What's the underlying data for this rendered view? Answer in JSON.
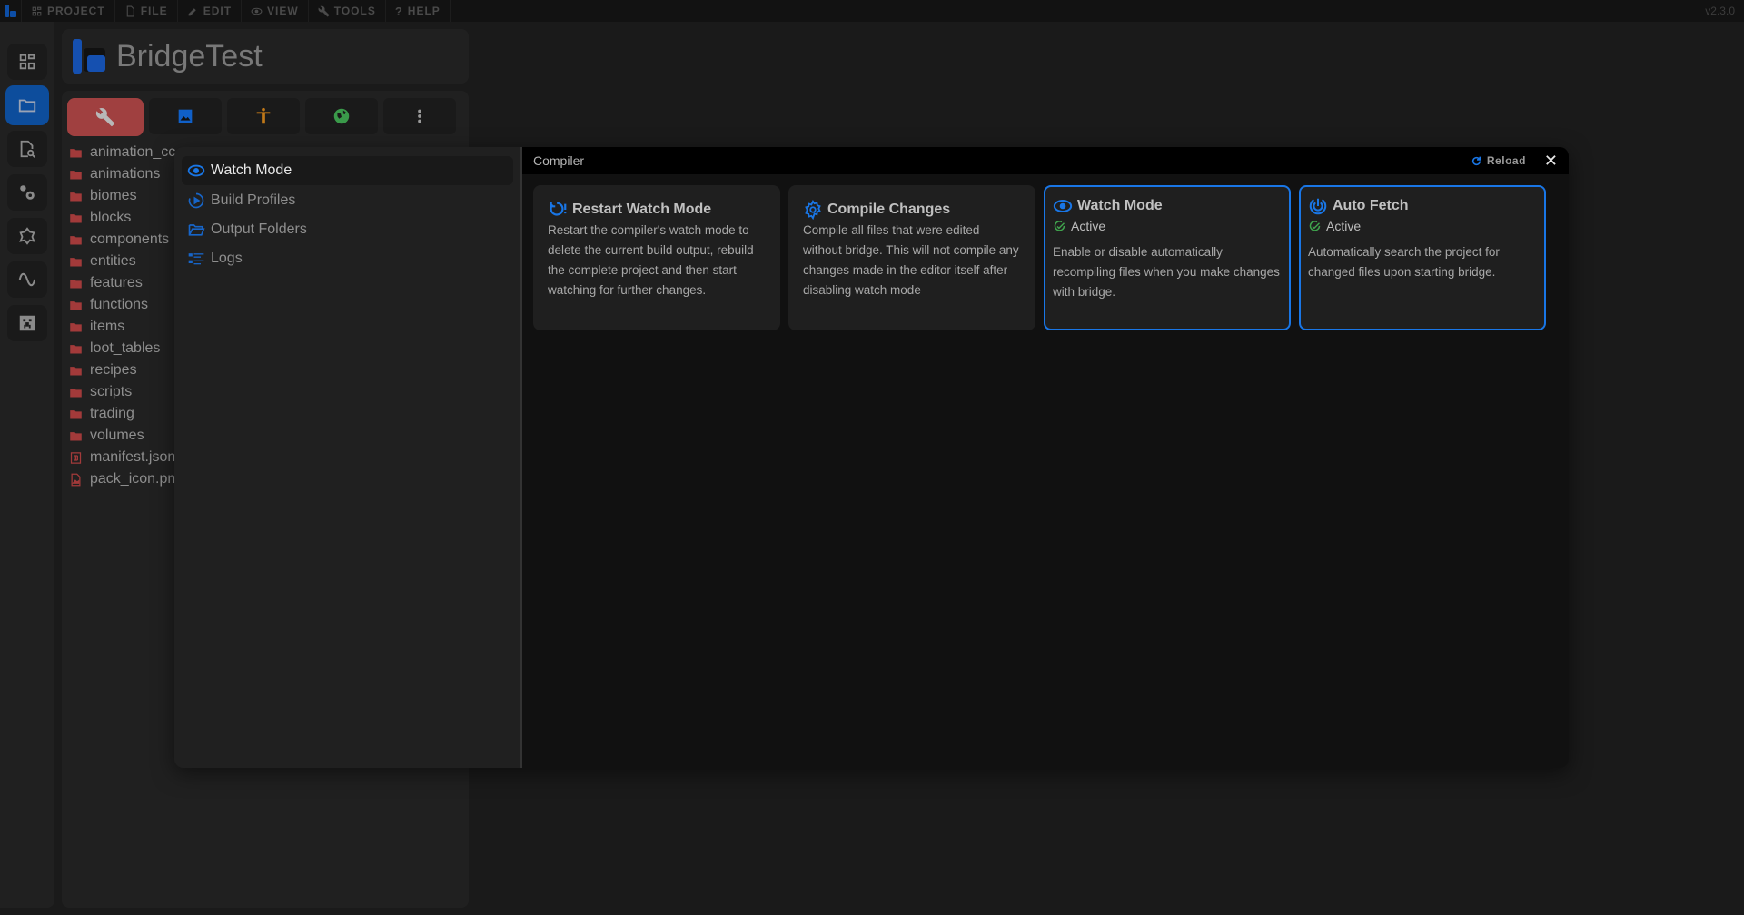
{
  "menubar": {
    "items": [
      {
        "label": "PROJECT",
        "icon": "dashboard-icon"
      },
      {
        "label": "FILE",
        "icon": "file-icon"
      },
      {
        "label": "EDIT",
        "icon": "pencil-icon"
      },
      {
        "label": "VIEW",
        "icon": "eye-icon"
      },
      {
        "label": "TOOLS",
        "icon": "wrench-icon"
      },
      {
        "label": "HELP",
        "icon": "question-icon"
      }
    ],
    "version": "v2.3.0"
  },
  "sidebar": {
    "items": [
      {
        "name": "dashboard",
        "icon": "dashboard-icon",
        "active": false
      },
      {
        "name": "file-explorer",
        "icon": "folder-icon",
        "active": true
      },
      {
        "name": "find-in-files",
        "icon": "file-search-icon",
        "active": false
      },
      {
        "name": "compiler",
        "icon": "cogs-icon",
        "active": false
      },
      {
        "name": "extensions",
        "icon": "puzzle-icon",
        "active": false
      },
      {
        "name": "functions",
        "icon": "wave-icon",
        "active": false
      },
      {
        "name": "minecraft",
        "icon": "creeper-icon",
        "active": false
      }
    ]
  },
  "project": {
    "title": "BridgeTest",
    "packs": [
      {
        "name": "behavior-pack",
        "icon": "wrench-icon",
        "color": "#a04040",
        "active": true
      },
      {
        "name": "resource-pack",
        "icon": "image-icon",
        "color": "#1060c8",
        "active": false
      },
      {
        "name": "skin-pack",
        "icon": "person-icon",
        "color": "#c07818",
        "active": false
      },
      {
        "name": "world",
        "icon": "globe-icon",
        "color": "#3a9a4a",
        "active": false
      },
      {
        "name": "more",
        "icon": "more-vertical-icon",
        "color": "#9a9a9a",
        "active": false
      }
    ],
    "files": [
      {
        "label": "animation_cc",
        "type": "folder"
      },
      {
        "label": "animations",
        "type": "folder"
      },
      {
        "label": "biomes",
        "type": "folder"
      },
      {
        "label": "blocks",
        "type": "folder"
      },
      {
        "label": "components",
        "type": "folder"
      },
      {
        "label": "entities",
        "type": "folder"
      },
      {
        "label": "features",
        "type": "folder"
      },
      {
        "label": "functions",
        "type": "folder"
      },
      {
        "label": "items",
        "type": "folder"
      },
      {
        "label": "loot_tables",
        "type": "folder"
      },
      {
        "label": "recipes",
        "type": "folder"
      },
      {
        "label": "scripts",
        "type": "folder"
      },
      {
        "label": "trading",
        "type": "folder"
      },
      {
        "label": "volumes",
        "type": "folder"
      },
      {
        "label": "manifest.json",
        "type": "json"
      },
      {
        "label": "pack_icon.png",
        "type": "image"
      }
    ]
  },
  "dialog": {
    "title": "Compiler",
    "reload_label": "Reload",
    "nav": [
      {
        "label": "Watch Mode",
        "icon": "eye-icon",
        "active": true
      },
      {
        "label": "Build Profiles",
        "icon": "play-circle-icon",
        "active": false
      },
      {
        "label": "Output Folders",
        "icon": "folder-open-icon",
        "active": false
      },
      {
        "label": "Logs",
        "icon": "list-icon",
        "active": false
      }
    ],
    "cards": [
      {
        "title": "Restart Watch Mode",
        "icon": "restart-alert-icon",
        "status": null,
        "description": "Restart the compiler's watch mode to delete the current build output, rebuild the complete project and then start watching for further changes."
      },
      {
        "title": "Compile Changes",
        "icon": "gear-icon",
        "status": null,
        "description": "Compile all files that were edited without bridge. This will not compile any changes made in the editor itself after disabling watch mode"
      },
      {
        "title": "Watch Mode",
        "icon": "eye-icon",
        "status": "Active",
        "description": "Enable or disable automatically recompiling files when you make changes with bridge."
      },
      {
        "title": "Auto Fetch",
        "icon": "radar-icon",
        "status": "Active",
        "description": "Automatically search the project for changed files upon starting bridge."
      }
    ]
  },
  "colors": {
    "accent": "#1976e6",
    "active_sidebar": "#0d4d9c",
    "behavior_pack": "#a04040",
    "status_ok": "#3fa34d",
    "folder": "#a23a3a"
  }
}
